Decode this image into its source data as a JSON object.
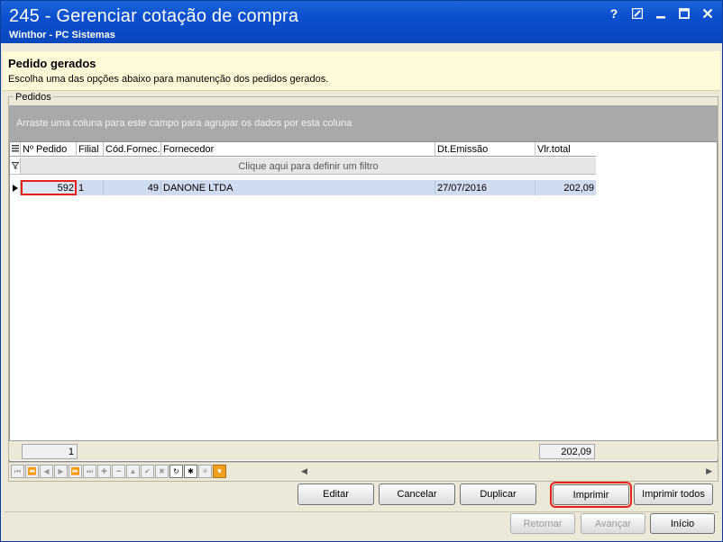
{
  "window": {
    "title": "245 - Gerenciar cotação de compra",
    "subtitle": "Winthor - PC Sistemas"
  },
  "header": {
    "title": "Pedido gerados",
    "description": "Escolha uma das opções abaixo para manutenção dos pedidos gerados."
  },
  "group": {
    "label": "Pedidos",
    "group_area_text": "Arraste uma coluna para este campo para agrupar os dados por esta coluna"
  },
  "grid": {
    "columns": [
      "Nº Pedido",
      "Filial",
      "Cód.Fornec.",
      "Fornecedor",
      "Dt.Emissão",
      "Vlr.total"
    ],
    "filter_text": "Clique aqui para definir um filtro",
    "rows": [
      {
        "pedido": "592",
        "filial": "1",
        "cod_fornec": "49",
        "fornecedor": "DANONE LTDA",
        "dt_emissao": "27/07/2016",
        "vlr_total": "202,09"
      }
    ],
    "footer": {
      "count": "1",
      "total": "202,09"
    }
  },
  "buttons": {
    "editar": "Editar",
    "cancelar": "Cancelar",
    "duplicar": "Duplicar",
    "imprimir": "Imprimir",
    "imprimir_todos": "Imprimir todos",
    "retornar": "Retornar",
    "avancar": "Avançar",
    "inicio": "Início"
  }
}
